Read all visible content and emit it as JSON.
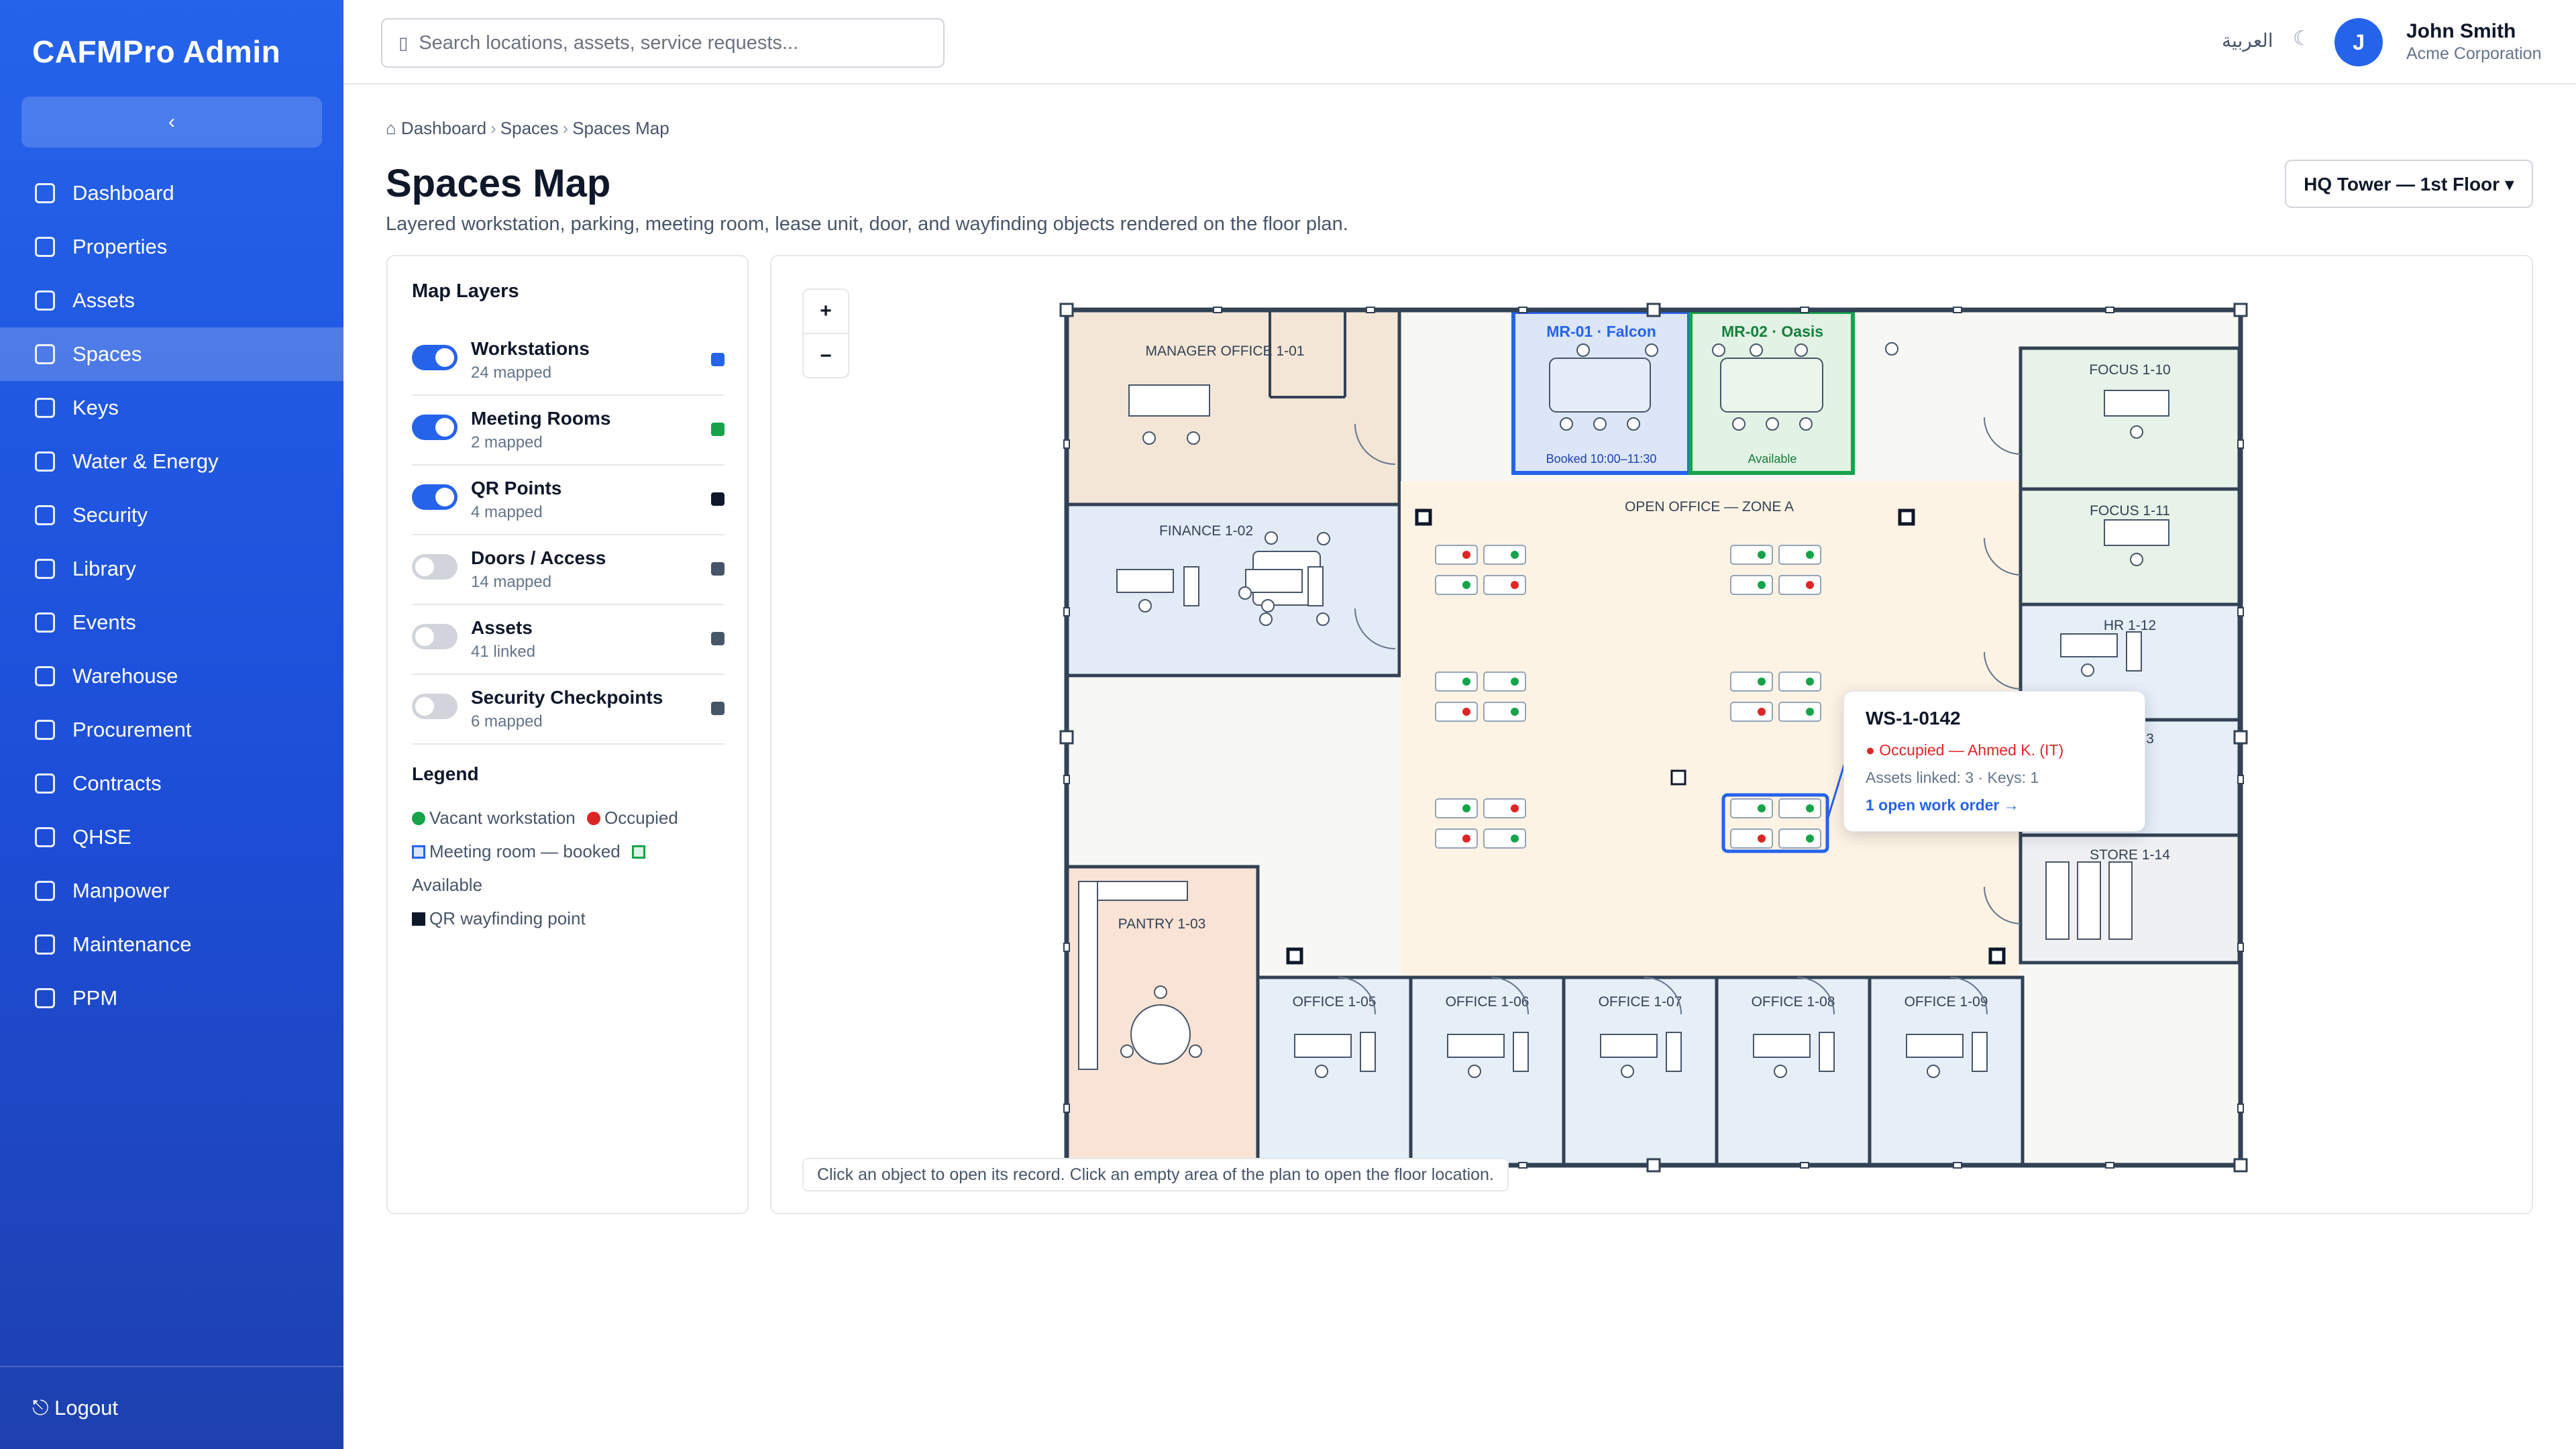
{
  "app": {
    "title": "CAFMPro Admin",
    "collapse_icon": "‹"
  },
  "sidebar": {
    "items": [
      {
        "label": "Dashboard",
        "active": false
      },
      {
        "label": "Properties",
        "active": false
      },
      {
        "label": "Assets",
        "active": false
      },
      {
        "label": "Spaces",
        "active": true
      },
      {
        "label": "Keys",
        "active": false
      },
      {
        "label": "Water & Energy",
        "active": false
      },
      {
        "label": "Security",
        "active": false
      },
      {
        "label": "Library",
        "active": false
      },
      {
        "label": "Events",
        "active": false
      },
      {
        "label": "Warehouse",
        "active": false
      },
      {
        "label": "Procurement",
        "active": false
      },
      {
        "label": "Contracts",
        "active": false
      },
      {
        "label": "QHSE",
        "active": false
      },
      {
        "label": "Manpower",
        "active": false
      },
      {
        "label": "Maintenance",
        "active": false
      },
      {
        "label": "PPM",
        "active": false
      }
    ],
    "logout_label": "⎋ Logout"
  },
  "topbar": {
    "search_placeholder": "Search locations, assets, service requests...",
    "search_icon": "▯",
    "language_label": "العربية",
    "theme_icon": "☾",
    "avatar_initial": "J",
    "user_name": "John Smith",
    "user_org": "Acme Corporation"
  },
  "breadcrumb": [
    "⌂ Dashboard",
    "Spaces",
    "Spaces Map"
  ],
  "page": {
    "title": "Spaces Map",
    "subtitle": "Layered workstation, parking, meeting room, lease unit, door, and wayfinding objects rendered on the floor plan.",
    "floor_selector": "HQ Tower — 1st Floor ▾"
  },
  "layers": {
    "title": "Map Layers",
    "items": [
      {
        "name": "Workstations",
        "count": "24 mapped",
        "on": true,
        "color": "#2563eb"
      },
      {
        "name": "Meeting Rooms",
        "count": "2 mapped",
        "on": true,
        "color": "#16a34a"
      },
      {
        "name": "QR Points",
        "count": "4 mapped",
        "on": true,
        "color": "#0f172a"
      },
      {
        "name": "Doors / Access",
        "count": "14 mapped",
        "on": false,
        "color": "#475569"
      },
      {
        "name": "Assets",
        "count": "41 linked",
        "on": false,
        "color": "#475569"
      },
      {
        "name": "Security Checkpoints",
        "count": "6 mapped",
        "on": false,
        "color": "#475569"
      }
    ]
  },
  "legend": {
    "title": "Legend",
    "vacant": "Vacant workstation",
    "occupied": "Occupied",
    "meeting_booked": "Meeting room — booked",
    "available": "Available",
    "qr": "QR wayfinding point",
    "colors": {
      "vacant": "#16a34a",
      "occupied": "#dc2626",
      "meeting_booked": "#2563eb",
      "available": "#16a34a",
      "qr": "#0f172a"
    }
  },
  "map": {
    "zoom_in": "+",
    "zoom_out": "−",
    "hint": "Click an object to open its record. Click an empty area of the plan to open the floor location.",
    "rooms": {
      "manager_office": "MANAGER OFFICE 1-01",
      "finance": "FINANCE 1-02",
      "pantry": "PANTRY 1-03",
      "mr01": "MR-01 · Falcon",
      "mr01_status": "Booked 10:00–11:30",
      "mr02": "MR-02 · Oasis",
      "mr02_status": "Available",
      "open_office": "OPEN OFFICE — ZONE A",
      "office_105": "OFFICE 1-05",
      "office_106": "OFFICE 1-06",
      "office_107": "OFFICE 1-07",
      "office_108": "OFFICE 1-08",
      "office_109": "OFFICE 1-09",
      "focus_110": "FOCUS 1-10",
      "focus_111": "FOCUS 1-11",
      "hr_112": "HR 1-12",
      "room_113_partial": "3",
      "store_114": "STORE 1-14"
    },
    "colors": {
      "wall": "#334155",
      "manager": "#f3e6d6",
      "finance": "#e3ebf6",
      "pantry": "#f9e3d5",
      "open_office": "#fdf3e4",
      "corridor": "#f7f8f4",
      "mr_booked": "#dce6f7",
      "mr_available": "#e2f2e4",
      "focus": "#e7f3e8",
      "office": "#e6eef8",
      "store": "#eff0f1"
    }
  },
  "popup": {
    "title": "WS-1-0142",
    "status": "● Occupied — Ahmed K. (IT)",
    "meta": "Assets linked: 3 · Keys: 1",
    "link": "1 open work order →"
  }
}
